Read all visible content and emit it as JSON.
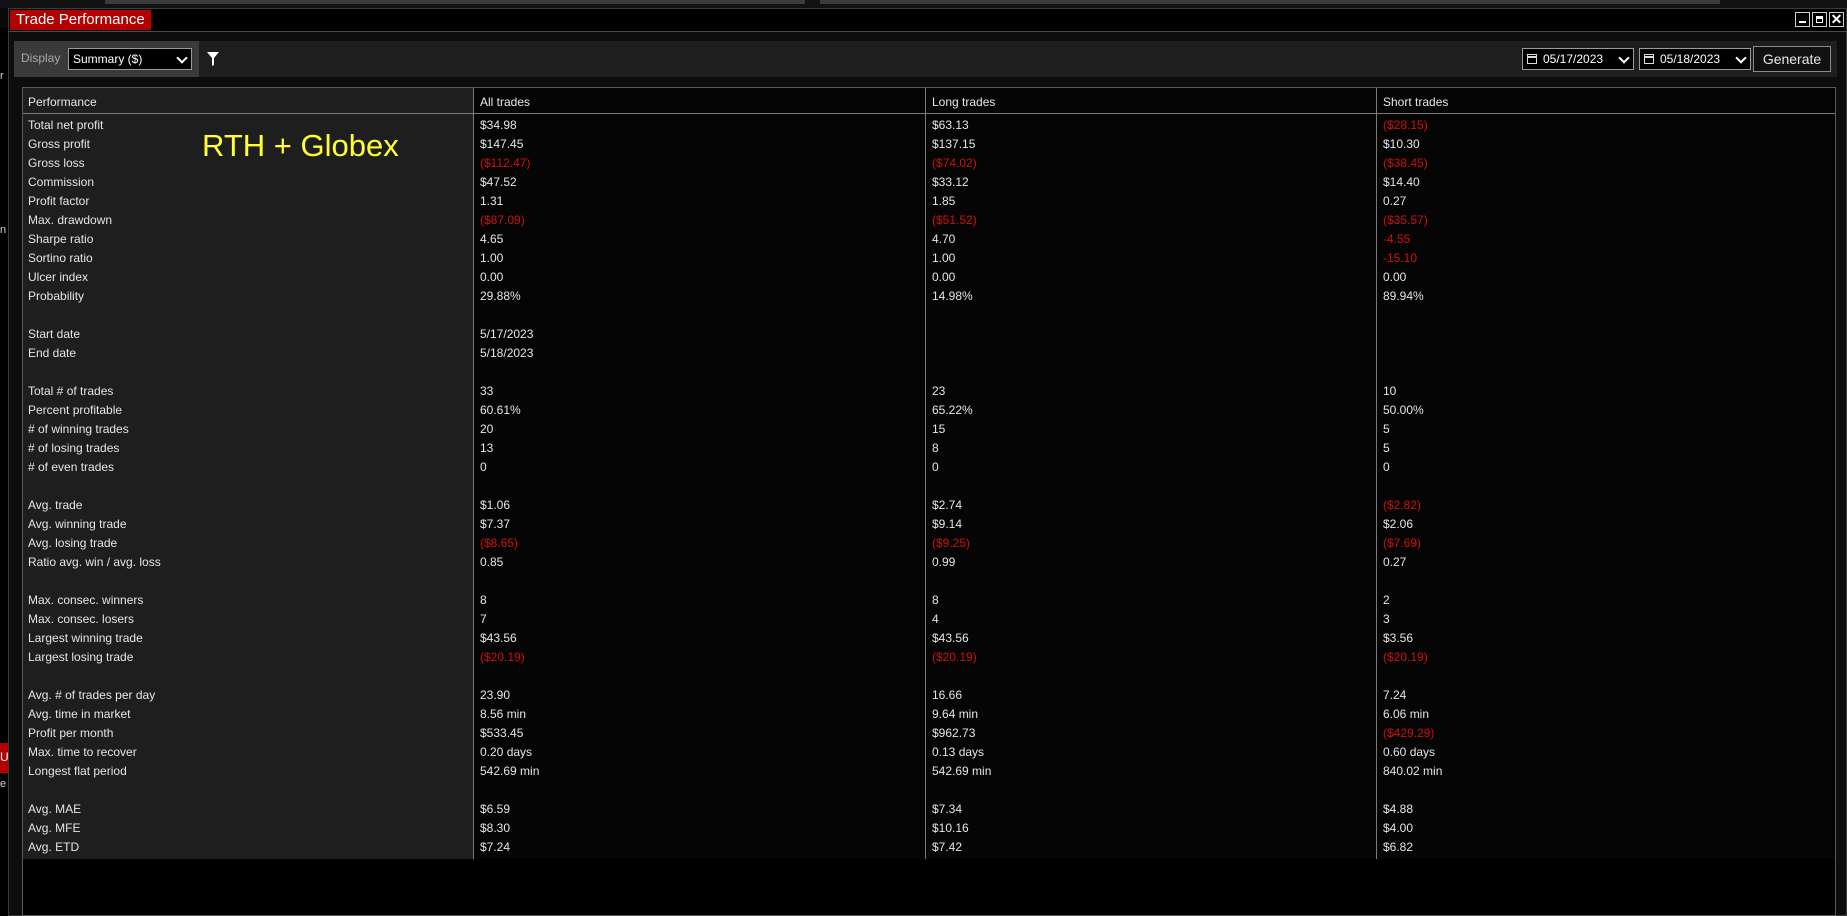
{
  "window": {
    "title": "Trade Performance"
  },
  "left_edge": {
    "chars": [
      "r",
      "n",
      "U",
      "e"
    ]
  },
  "toolbar": {
    "display_label": "Display",
    "display_value": "Summary ($)",
    "from_date": "05/17/2023",
    "to_date": "05/18/2023",
    "generate_label": "Generate"
  },
  "annotation": "RTH + Globex",
  "table": {
    "columns": [
      "Performance",
      "All trades",
      "Long trades",
      "Short trades"
    ],
    "rows": [
      {
        "label": "Total net profit",
        "all": "$34.98",
        "long": "$63.13",
        "short": "($28.15)",
        "neg": [
          false,
          false,
          true
        ]
      },
      {
        "label": "Gross profit",
        "all": "$147.45",
        "long": "$137.15",
        "short": "$10.30",
        "neg": [
          false,
          false,
          false
        ]
      },
      {
        "label": "Gross loss",
        "all": "($112.47)",
        "long": "($74.02)",
        "short": "($38.45)",
        "neg": [
          true,
          true,
          true
        ]
      },
      {
        "label": "Commission",
        "all": "$47.52",
        "long": "$33.12",
        "short": "$14.40",
        "neg": [
          false,
          false,
          false
        ]
      },
      {
        "label": "Profit factor",
        "all": "1.31",
        "long": "1.85",
        "short": "0.27",
        "neg": [
          false,
          false,
          false
        ]
      },
      {
        "label": "Max. drawdown",
        "all": "($87.09)",
        "long": "($51.52)",
        "short": "($35.57)",
        "neg": [
          true,
          true,
          true
        ]
      },
      {
        "label": "Sharpe ratio",
        "all": "4.65",
        "long": "4.70",
        "short": "-4.55",
        "neg": [
          false,
          false,
          true
        ]
      },
      {
        "label": "Sortino ratio",
        "all": "1.00",
        "long": "1.00",
        "short": "-15.10",
        "neg": [
          false,
          false,
          true
        ]
      },
      {
        "label": "Ulcer index",
        "all": "0.00",
        "long": "0.00",
        "short": "0.00",
        "neg": [
          false,
          false,
          false
        ]
      },
      {
        "label": "Probability",
        "all": "29.88%",
        "long": "14.98%",
        "short": "89.94%",
        "neg": [
          false,
          false,
          false
        ]
      },
      {
        "label": "",
        "all": "",
        "long": "",
        "short": "",
        "neg": [
          false,
          false,
          false
        ]
      },
      {
        "label": "Start date",
        "all": "5/17/2023",
        "long": "",
        "short": "",
        "neg": [
          false,
          false,
          false
        ]
      },
      {
        "label": "End date",
        "all": "5/18/2023",
        "long": "",
        "short": "",
        "neg": [
          false,
          false,
          false
        ]
      },
      {
        "label": "",
        "all": "",
        "long": "",
        "short": "",
        "neg": [
          false,
          false,
          false
        ]
      },
      {
        "label": "Total # of trades",
        "all": "33",
        "long": "23",
        "short": "10",
        "neg": [
          false,
          false,
          false
        ]
      },
      {
        "label": "Percent profitable",
        "all": "60.61%",
        "long": "65.22%",
        "short": "50.00%",
        "neg": [
          false,
          false,
          false
        ]
      },
      {
        "label": "# of winning trades",
        "all": "20",
        "long": "15",
        "short": "5",
        "neg": [
          false,
          false,
          false
        ]
      },
      {
        "label": "# of losing trades",
        "all": "13",
        "long": "8",
        "short": "5",
        "neg": [
          false,
          false,
          false
        ]
      },
      {
        "label": "# of even trades",
        "all": "0",
        "long": "0",
        "short": "0",
        "neg": [
          false,
          false,
          false
        ]
      },
      {
        "label": "",
        "all": "",
        "long": "",
        "short": "",
        "neg": [
          false,
          false,
          false
        ]
      },
      {
        "label": "Avg. trade",
        "all": "$1.06",
        "long": "$2.74",
        "short": "($2.82)",
        "neg": [
          false,
          false,
          true
        ]
      },
      {
        "label": "Avg. winning trade",
        "all": "$7.37",
        "long": "$9.14",
        "short": "$2.06",
        "neg": [
          false,
          false,
          false
        ]
      },
      {
        "label": "Avg. losing trade",
        "all": "($8.65)",
        "long": "($9.25)",
        "short": "($7.69)",
        "neg": [
          true,
          true,
          true
        ]
      },
      {
        "label": "Ratio avg. win / avg. loss",
        "all": "0.85",
        "long": "0.99",
        "short": "0.27",
        "neg": [
          false,
          false,
          false
        ]
      },
      {
        "label": "",
        "all": "",
        "long": "",
        "short": "",
        "neg": [
          false,
          false,
          false
        ]
      },
      {
        "label": "Max. consec. winners",
        "all": "8",
        "long": "8",
        "short": "2",
        "neg": [
          false,
          false,
          false
        ]
      },
      {
        "label": "Max. consec. losers",
        "all": "7",
        "long": "4",
        "short": "3",
        "neg": [
          false,
          false,
          false
        ]
      },
      {
        "label": "Largest winning trade",
        "all": "$43.56",
        "long": "$43.56",
        "short": "$3.56",
        "neg": [
          false,
          false,
          false
        ]
      },
      {
        "label": "Largest losing trade",
        "all": "($20.19)",
        "long": "($20.19)",
        "short": "($20.19)",
        "neg": [
          true,
          true,
          true
        ]
      },
      {
        "label": "",
        "all": "",
        "long": "",
        "short": "",
        "neg": [
          false,
          false,
          false
        ]
      },
      {
        "label": "Avg. # of trades per day",
        "all": "23.90",
        "long": "16.66",
        "short": "7.24",
        "neg": [
          false,
          false,
          false
        ]
      },
      {
        "label": "Avg. time in market",
        "all": "8.56 min",
        "long": "9.64 min",
        "short": "6.06 min",
        "neg": [
          false,
          false,
          false
        ]
      },
      {
        "label": "Profit per month",
        "all": "$533.45",
        "long": "$962.73",
        "short": "($429.29)",
        "neg": [
          false,
          false,
          true
        ]
      },
      {
        "label": "Max. time to recover",
        "all": "0.20 days",
        "long": "0.13 days",
        "short": "0.60 days",
        "neg": [
          false,
          false,
          false
        ]
      },
      {
        "label": "Longest flat period",
        "all": "542.69 min",
        "long": "542.69 min",
        "short": "840.02 min",
        "neg": [
          false,
          false,
          false
        ]
      },
      {
        "label": "",
        "all": "",
        "long": "",
        "short": "",
        "neg": [
          false,
          false,
          false
        ]
      },
      {
        "label": "Avg. MAE",
        "all": "$6.59",
        "long": "$7.34",
        "short": "$4.88",
        "neg": [
          false,
          false,
          false
        ]
      },
      {
        "label": "Avg. MFE",
        "all": "$8.30",
        "long": "$10.16",
        "short": "$4.00",
        "neg": [
          false,
          false,
          false
        ]
      },
      {
        "label": "Avg. ETD",
        "all": "$7.24",
        "long": "$7.42",
        "short": "$6.82",
        "neg": [
          false,
          false,
          false
        ]
      }
    ]
  },
  "colors": {
    "accent": "#b30000",
    "negative": "#d01010",
    "annotation": "#ffff33"
  }
}
